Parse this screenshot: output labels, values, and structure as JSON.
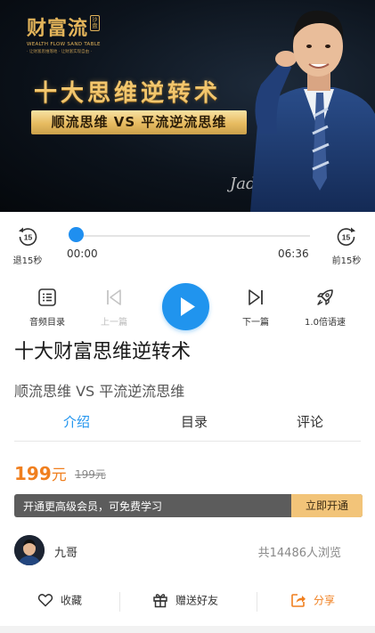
{
  "banner": {
    "logo_main": "财富流",
    "logo_badge": "沙盘",
    "logo_en": "WEALTH FLOW SAND TABLE",
    "logo_sub": "· 让财富思维落地 · 让财富实现自由 ·",
    "title": "十大思维逆转术",
    "ribbon": "顺流思维 VS 平流逆流思维",
    "signature": "Jaden"
  },
  "player": {
    "skip_back_label": "退15秒",
    "skip_back_num": "15",
    "skip_fwd_label": "前15秒",
    "skip_fwd_num": "15",
    "time_current": "00:00",
    "time_total": "06:36",
    "progress": 0.0
  },
  "controls": {
    "catalog_label": "音频目录",
    "prev_label": "上一篇",
    "next_label": "下一篇",
    "speed_label": "1.0倍语速"
  },
  "main_title": "十大财富思维逆转术",
  "sub_title": "顺流思维 VS 平流逆流思维",
  "tabs": [
    {
      "label": "介绍",
      "active": true
    },
    {
      "label": "目录",
      "active": false
    },
    {
      "label": "评论",
      "active": false
    }
  ],
  "price": {
    "amount": "199",
    "unit": "元",
    "original": "199元"
  },
  "member": {
    "text": "开通更高级会员，可免费学习",
    "button": "立即开通"
  },
  "author": {
    "name": "九哥",
    "views": "共14486人浏览"
  },
  "bottom_bar": {
    "favorite_label": "收藏",
    "gift_label": "赠送好友",
    "share_label": "分享"
  },
  "colors": {
    "accent": "#2094ee",
    "price": "#f07f1e",
    "gold": "#f2c479"
  }
}
